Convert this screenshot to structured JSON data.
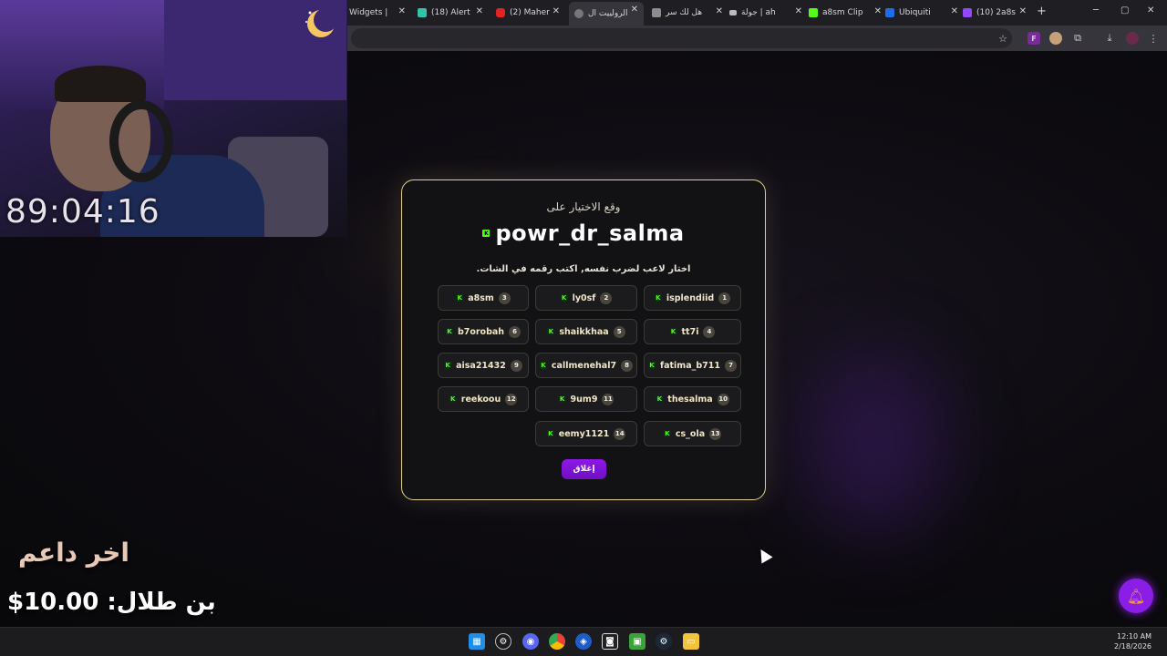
{
  "browser": {
    "tabs": [
      {
        "label": "Widgets | ",
        "color": "#2f6dea"
      },
      {
        "label": "(18) Alert",
        "color": "#31c4a9"
      },
      {
        "label": "(2) Maher",
        "color": "#e52222"
      },
      {
        "label": "الرولييت ال",
        "color": "#9a9a9a"
      },
      {
        "label": "هل لك سر",
        "color": "#b9b9b9"
      },
      {
        "label": "جولة | ah",
        "color": "#bbbbbb"
      },
      {
        "label": "a8sm Clip",
        "color": "#53fc18"
      },
      {
        "label": "Ubiquiti",
        "color": "#1d6ee6"
      },
      {
        "label": "(10) 2a8s",
        "color": "#9146ff"
      }
    ],
    "new_tab": "+",
    "win_min": "─",
    "win_max": "▢",
    "win_close": "✕"
  },
  "webcam": {
    "timer": "89:04:16"
  },
  "support": {
    "label": "اخر داعم",
    "value": "بن طلال: 10.00$"
  },
  "modal": {
    "subtitle": "وقع الاختيار على",
    "winner": "powr_dr_salma",
    "instruction": "اختار لاعب لضرب نفسه, اكتب رقمه في الشات.",
    "close_label": "إغلاق",
    "players": [
      {
        "num": "1",
        "name": "isplendiid"
      },
      {
        "num": "2",
        "name": "ly0sf"
      },
      {
        "num": "3",
        "name": "a8sm"
      },
      {
        "num": "4",
        "name": "tt7i"
      },
      {
        "num": "5",
        "name": "shaikkhaa"
      },
      {
        "num": "6",
        "name": "b7orobah"
      },
      {
        "num": "7",
        "name": "fatima_b711"
      },
      {
        "num": "8",
        "name": "callmenehal7"
      },
      {
        "num": "9",
        "name": "aisa21432"
      },
      {
        "num": "10",
        "name": "thesalma"
      },
      {
        "num": "11",
        "name": "9um9"
      },
      {
        "num": "12",
        "name": "reekoou"
      },
      {
        "num": "13",
        "name": "cs_ola"
      },
      {
        "num": "14",
        "name": "eemy1121"
      }
    ]
  },
  "taskbar": {
    "time": "12:10 AM",
    "date": "2/18/2026"
  },
  "colors": {
    "accent_gold": "#e2cf8a",
    "accent_purple": "#8f18e8",
    "kick_green": "#53fc18"
  }
}
